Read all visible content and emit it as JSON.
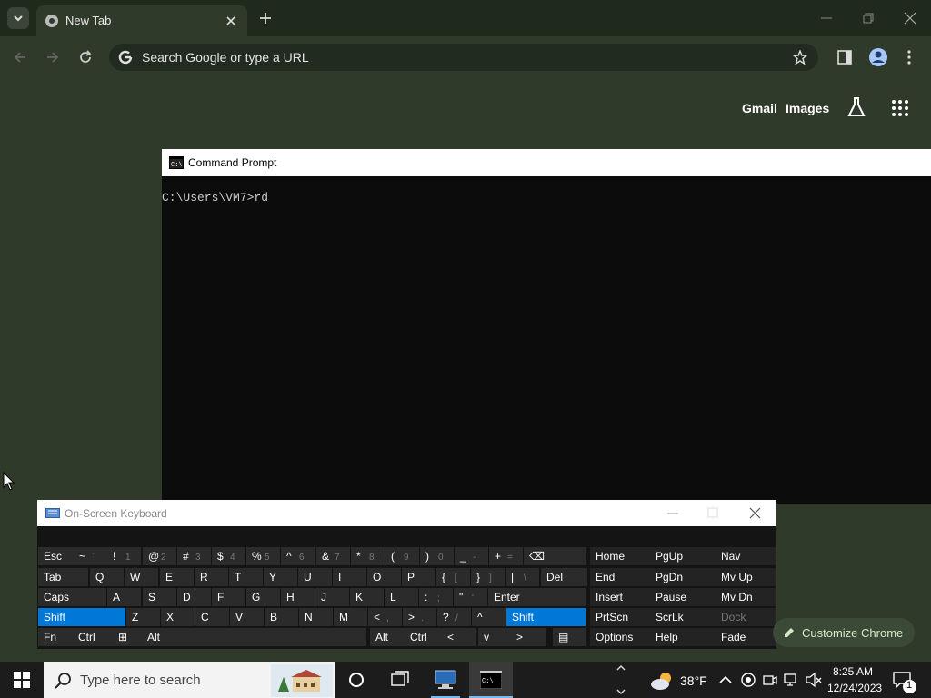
{
  "browser": {
    "tab_title": "New Tab",
    "omnibox_placeholder": "Search Google or type a URL",
    "links": {
      "gmail": "Gmail",
      "images": "Images"
    },
    "customize_label": "Customize Chrome"
  },
  "cmd": {
    "title": "Command Prompt",
    "line": "C:\\Users\\VM7>rd"
  },
  "osk": {
    "title": "On-Screen Keyboard",
    "rows": [
      [
        {
          "label": "Esc"
        },
        {
          "label": "~",
          "sub": "`"
        },
        {
          "label": "!",
          "sub": "1"
        },
        {
          "label": "@",
          "sub": "2"
        },
        {
          "label": "#",
          "sub": "3"
        },
        {
          "label": "$",
          "sub": "4"
        },
        {
          "label": "%",
          "sub": "5"
        },
        {
          "label": "^",
          "sub": "6"
        },
        {
          "label": "&",
          "sub": "7"
        },
        {
          "label": "*",
          "sub": "8"
        },
        {
          "label": "(",
          "sub": "9"
        },
        {
          "label": ")",
          "sub": "0"
        },
        {
          "label": "_",
          "sub": "-"
        },
        {
          "label": "+",
          "sub": "="
        },
        {
          "label": "⌫"
        }
      ],
      [
        {
          "label": "Tab"
        },
        {
          "label": "Q"
        },
        {
          "label": "W"
        },
        {
          "label": "E"
        },
        {
          "label": "R"
        },
        {
          "label": "T"
        },
        {
          "label": "Y"
        },
        {
          "label": "U"
        },
        {
          "label": "I"
        },
        {
          "label": "O"
        },
        {
          "label": "P"
        },
        {
          "label": "{",
          "sub": "["
        },
        {
          "label": "}",
          "sub": "]"
        },
        {
          "label": "|",
          "sub": "\\"
        },
        {
          "label": "Del"
        }
      ],
      [
        {
          "label": "Caps"
        },
        {
          "label": "A"
        },
        {
          "label": "S"
        },
        {
          "label": "D"
        },
        {
          "label": "F"
        },
        {
          "label": "G"
        },
        {
          "label": "H"
        },
        {
          "label": "J"
        },
        {
          "label": "K"
        },
        {
          "label": "L"
        },
        {
          "label": ":",
          "sub": ";"
        },
        {
          "label": "\"",
          "sub": "'"
        },
        {
          "label": "Enter"
        }
      ],
      [
        {
          "label": "Shift"
        },
        {
          "label": "Z"
        },
        {
          "label": "X"
        },
        {
          "label": "C"
        },
        {
          "label": "V"
        },
        {
          "label": "B"
        },
        {
          "label": "N"
        },
        {
          "label": "M"
        },
        {
          "label": "<",
          "sub": ","
        },
        {
          "label": ">",
          "sub": "."
        },
        {
          "label": "?",
          "sub": "/"
        },
        {
          "label": "^"
        },
        {
          "label": "Shift"
        }
      ],
      [
        {
          "label": "Fn"
        },
        {
          "label": "Ctrl"
        },
        {
          "label": "⊞"
        },
        {
          "label": "Alt"
        },
        {
          "label": ""
        },
        {
          "label": "Alt"
        },
        {
          "label": "Ctrl"
        },
        {
          "label": "<"
        },
        {
          "label": "v"
        },
        {
          "label": ">"
        },
        {
          "label": "▤"
        }
      ]
    ],
    "nav_rows": [
      [
        "Home",
        "PgUp",
        "Nav"
      ],
      [
        "End",
        "PgDn",
        "Mv Up"
      ],
      [
        "Insert",
        "Pause",
        "Mv Dn"
      ],
      [
        "PrtScn",
        "ScrLk",
        "Dock"
      ],
      [
        "Options",
        "Help",
        "Fade"
      ]
    ]
  },
  "taskbar": {
    "search_placeholder": "Type here to search",
    "temperature": "38°F",
    "time": "8:25 AM",
    "date": "12/24/2023",
    "notification_count": "1"
  }
}
